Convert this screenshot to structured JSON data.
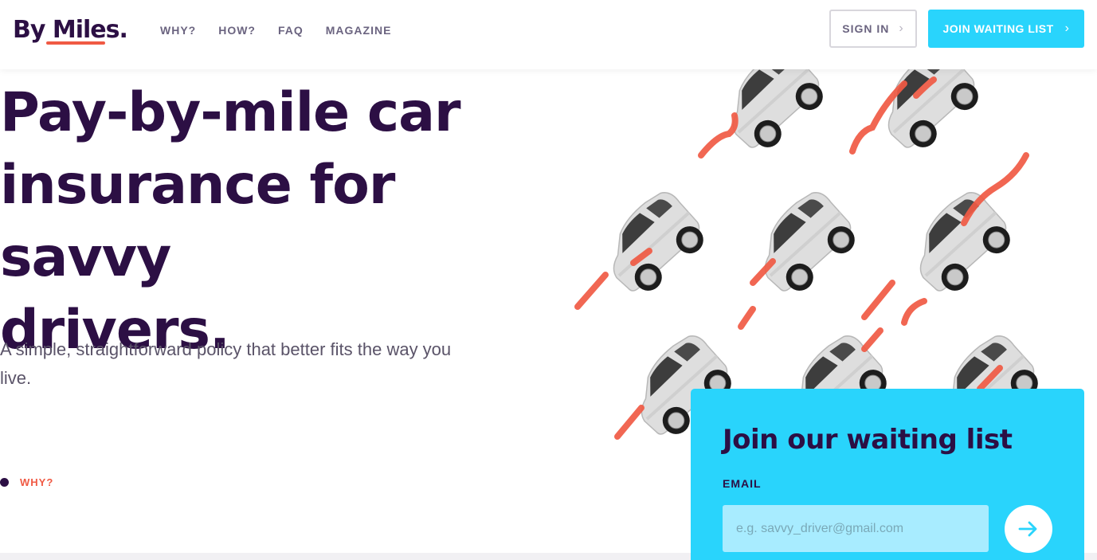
{
  "brand": {
    "logo_text": "By Miles.",
    "accent": "#f05a44",
    "primary": "#2c0f44",
    "cyan": "#29d4fc"
  },
  "nav": {
    "items": [
      "WHY?",
      "HOW?",
      "FAQ",
      "MAGAZINE"
    ]
  },
  "header": {
    "signin_label": "SIGN IN",
    "join_label": "JOIN WAITING LIST",
    "chevron": "›"
  },
  "hero": {
    "title_lines": [
      "Pay-by-mile car",
      "insurance for savvy",
      "drivers."
    ],
    "subtitle": "A simple, straightforward policy that better fits the way you live.",
    "section_link": "WHY?"
  },
  "waitlist": {
    "title": "Join our waiting list",
    "email_label": "EMAIL",
    "email_value": "",
    "email_placeholder": "e.g. savvy_driver@gmail.com",
    "submit_icon": "arrow-right-icon"
  }
}
